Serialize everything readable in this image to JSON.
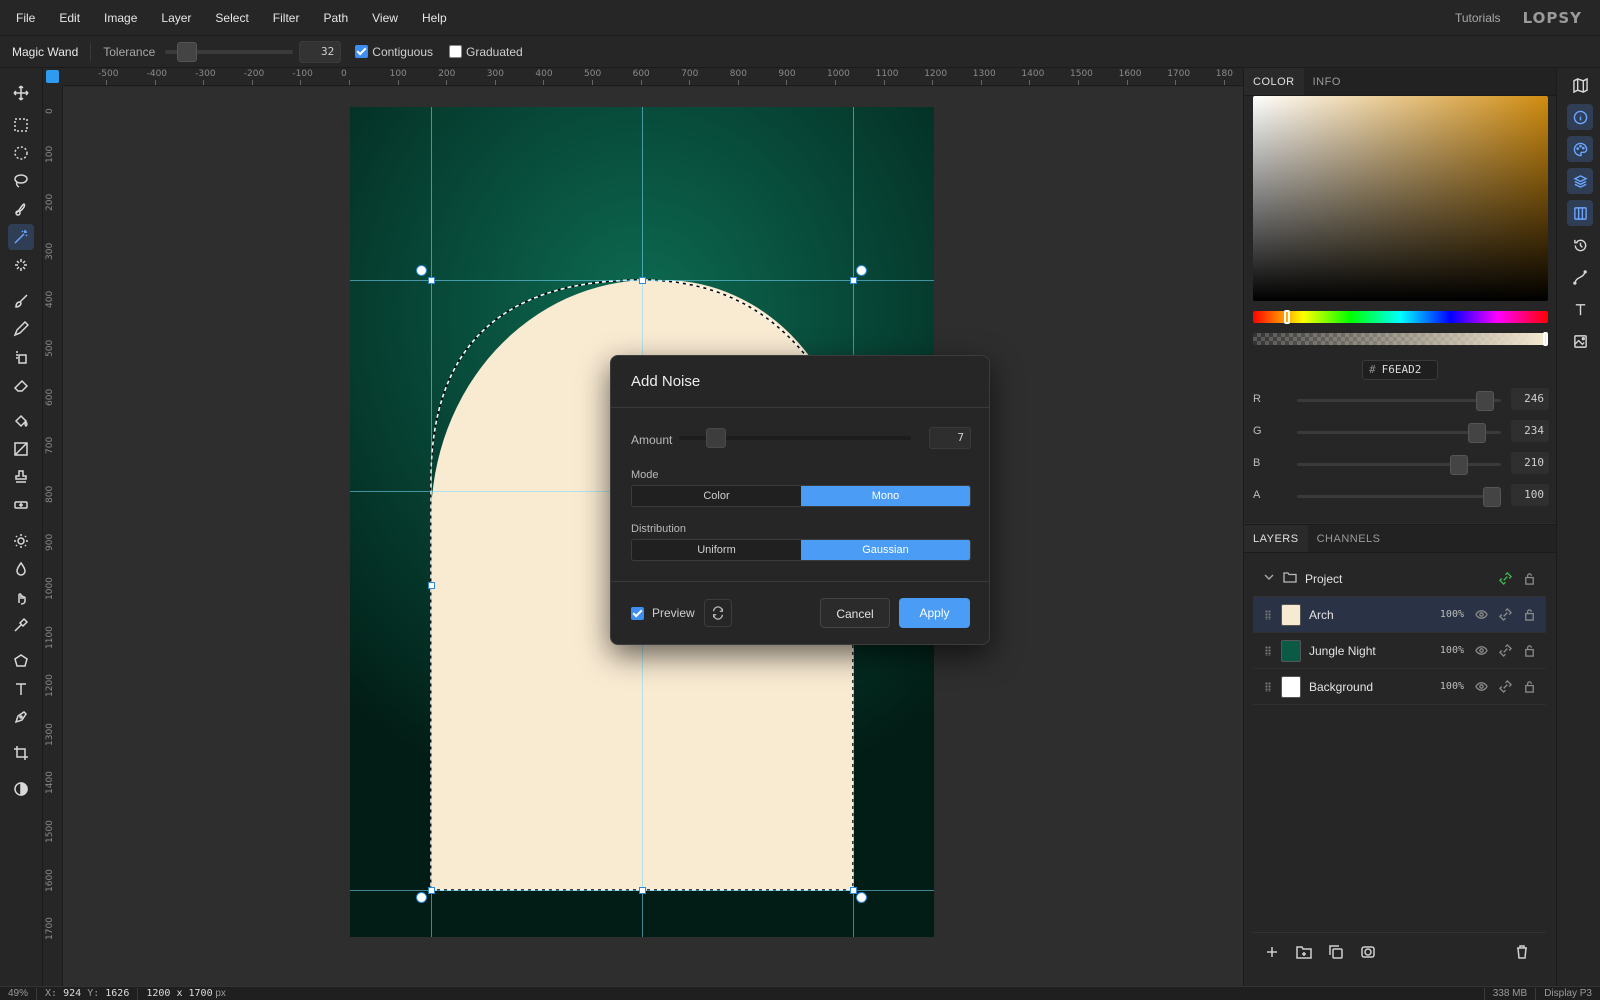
{
  "menu": {
    "items": [
      "File",
      "Edit",
      "Image",
      "Layer",
      "Select",
      "Filter",
      "Path",
      "View",
      "Help"
    ],
    "tutorials": "Tutorials",
    "logo": "LOPSY"
  },
  "options": {
    "tool_name": "Magic Wand",
    "tolerance_label": "Tolerance",
    "tolerance_value": "32",
    "contiguous_label": "Contiguous",
    "contiguous_checked": true,
    "graduated_label": "Graduated",
    "graduated_checked": false
  },
  "rulers": {
    "top": [
      "-500",
      "-400",
      "-300",
      "-200",
      "-100",
      "0",
      "100",
      "200",
      "300",
      "400",
      "500",
      "600",
      "700",
      "800",
      "900",
      "1000",
      "1100",
      "1200",
      "1300",
      "1400",
      "1500",
      "1600",
      "1700",
      "180"
    ],
    "left": [
      "0",
      "100",
      "200",
      "300",
      "400",
      "500",
      "600",
      "700",
      "800",
      "900",
      "1000",
      "1100",
      "1200",
      "1300",
      "1400",
      "1500",
      "1600",
      "1700"
    ]
  },
  "tools": [
    "move-icon",
    "rect-select-icon",
    "ellipse-select-icon",
    "lasso-icon",
    "quick-select-icon",
    "magic-wand-icon",
    "object-select-icon",
    "brush-icon",
    "pencil-icon",
    "clone-icon",
    "eraser-icon",
    "bucket-icon",
    "gradient-icon",
    "stamp-icon",
    "healing-icon",
    "dodge-icon",
    "blur-icon",
    "smudge-icon",
    "eyedropper-icon",
    "shape-icon",
    "text-icon",
    "pen-icon",
    "crop-icon",
    "contrast-icon"
  ],
  "dialog": {
    "title": "Add Noise",
    "amount_label": "Amount",
    "amount_value": "7",
    "amount_fraction": 0.07,
    "mode_label": "Mode",
    "mode_options": [
      "Color",
      "Mono"
    ],
    "mode_selected": "Mono",
    "distribution_label": "Distribution",
    "distribution_options": [
      "Uniform",
      "Gaussian"
    ],
    "distribution_selected": "Gaussian",
    "preview_label": "Preview",
    "preview_checked": true,
    "cancel_label": "Cancel",
    "apply_label": "Apply"
  },
  "color_panel": {
    "tabs": [
      "COLOR",
      "INFO"
    ],
    "active_tab": "COLOR",
    "hex_prefix": "#",
    "hex": "F6EAD2",
    "channels": [
      {
        "label": "R",
        "value": "246",
        "fraction": 0.965
      },
      {
        "label": "G",
        "value": "234",
        "fraction": 0.918
      },
      {
        "label": "B",
        "value": "210",
        "fraction": 0.824
      },
      {
        "label": "A",
        "value": "100",
        "fraction": 1.0
      }
    ]
  },
  "layers_panel": {
    "tabs": [
      "LAYERS",
      "CHANNELS"
    ],
    "active_tab": "LAYERS",
    "group": "Project",
    "layers": [
      {
        "name": "Arch",
        "opacity": "100%",
        "selected": true,
        "thumb": "#f6ead2"
      },
      {
        "name": "Jungle Night",
        "opacity": "100%",
        "selected": false,
        "thumb": "#0b5a45"
      },
      {
        "name": "Background",
        "opacity": "100%",
        "selected": false,
        "thumb": "#ffffff"
      }
    ]
  },
  "status": {
    "zoom": "49%",
    "x_label": "X:",
    "x": "924",
    "y_label": "Y:",
    "y": "1626",
    "doc_size": "1200 x 1700",
    "doc_unit": "px",
    "memory": "338 MB",
    "profile": "Display P3"
  },
  "colors": {
    "accent": "#4a9cf5",
    "arch": "#f6ead2",
    "background_dark": "#262626"
  }
}
